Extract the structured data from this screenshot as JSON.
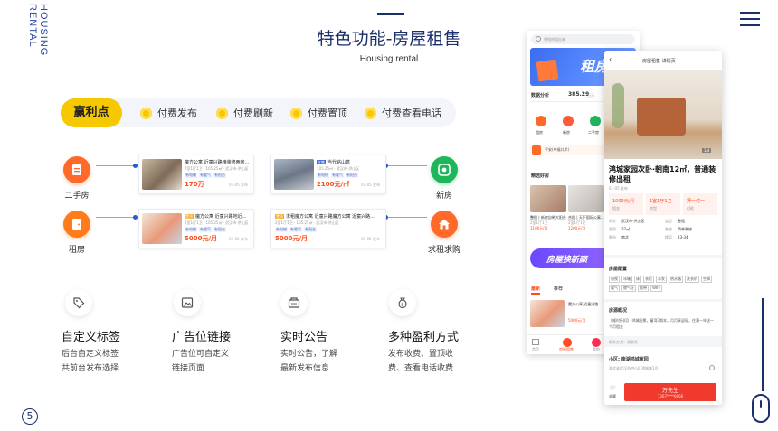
{
  "brand": {
    "line1": "HOUSING",
    "line2": "RENTAL"
  },
  "header": {
    "title": "特色功能-房屋租售",
    "subtitle": "Housing rental"
  },
  "monetize": {
    "label": "赢利点",
    "items": [
      "付费发布",
      "付费刷新",
      "付费置顶",
      "付费查看电话"
    ]
  },
  "categories": {
    "used": "二手房",
    "new": "新房",
    "rent": "租房",
    "want": "求租求购"
  },
  "cards": [
    {
      "title": "魔方公寓 近童兴路精装修两房...",
      "sub": "2室1厅1卫 · 105.25㎡ · 武汉市-洪山区",
      "tags": [
        "有电梯",
        "有暖气",
        "有阳台"
      ],
      "price": "170万",
      "date": "01-05 发布"
    },
    {
      "tag": "在售",
      "title": "当代铭山筑",
      "sub": "105.25㎡ · 武汉市-洪山区",
      "tags": [
        "有电梯",
        "有暖气",
        "有阳台"
      ],
      "price": "2100元/㎡",
      "date": "01-05 发布"
    },
    {
      "tag": "置顶",
      "title": "魔方公寓 近童兴路地近...",
      "sub": "2室1厅1卫 · 105.25㎡ · 武汉市-洪山区",
      "tags": [
        "有电梯",
        "有暖气",
        "有阳台"
      ],
      "price": "5000元/月",
      "date": "01-05 发布"
    },
    {
      "tag": "置顶",
      "title": "求租魔方公寓 近童兴路魔方公寓 近童兴路...",
      "sub": "2室1厅1卫 · 105.25㎡ · 武汉市-洪山区",
      "tags": [
        "有电梯",
        "有暖气",
        "有阳台"
      ],
      "price": "5000元/月",
      "date": "01-05 发布"
    }
  ],
  "features": [
    {
      "title": "自定义标签",
      "desc": "后台自定义标签 共前台发布选择"
    },
    {
      "title": "广告位链接",
      "desc": "广告位可自定义 链接页面"
    },
    {
      "title": "实时公告",
      "desc": "实时公告，了解 最新发布信息"
    },
    {
      "title": "多种盈利方式",
      "desc": "发布收费、置顶收 费、查看电话收费"
    }
  ],
  "page_number": "5",
  "phone1": {
    "search_placeholder": "想找的租出来",
    "banner": "租房",
    "stats_label": "数据分析",
    "stats_value": "385.29",
    "stats_unit": "万元",
    "shortcuts": [
      "租房",
      "新房",
      "二手房"
    ],
    "notice": "平安(幸福口岸)",
    "section": "精选好房",
    "picks": [
      {
        "title": "整租 | 新房自带大阳台...",
        "spec": "2室1厅1卫",
        "price": "1100元/月"
      },
      {
        "title": "合租 | 天下国际公寓...",
        "spec": "2室1厅1卫",
        "price": "1200元/月"
      }
    ],
    "promo": "房屋换新颜",
    "tabs": [
      "最新",
      "推荐"
    ],
    "latest_title": "魔方公寓 近童兴路...",
    "latest_price": "5000元/月",
    "nav": [
      "首页",
      "房屋租售",
      "我的"
    ]
  },
  "phone2": {
    "header": "房屋租售-详情页",
    "photo_count": "1/4",
    "title": "鸿城家园次卧·朝南12㎡，普通装修出租",
    "date": "01-05 发布",
    "price_boxes": [
      {
        "value": "1000元/月",
        "label": "租金"
      },
      {
        "value": "1室1厅1卫",
        "label": "房型"
      },
      {
        "value": "押一付一",
        "label": "付款"
      }
    ],
    "info": [
      [
        "地址",
        "武汉市-洪山区",
        "类型",
        "整租"
      ],
      [
        "面积",
        "32㎡",
        "装修",
        "简单装修"
      ],
      [
        "朝向",
        "南北",
        "楼层",
        "23-34"
      ]
    ],
    "config_title": "房屋配置",
    "config_items": [
      "电视",
      "冰箱",
      "床",
      "衣柜",
      "沙发",
      "热水器",
      "洗衣机",
      "空调",
      "暖气",
      "燃气灶",
      "宽带",
      "WIFI"
    ],
    "desc_title": "房源概况",
    "desc_text": "【顺时折扣】-鸿城园景，童湾3期本，月月享返现，住满一年送一个月租金",
    "notice": "联系方式：请联系",
    "community_label": "小区: 南湖鸿城家园",
    "community_addr": "湖北省武汉市洪山区鸿城路1号",
    "fav": "收藏",
    "contact_name": "万先生",
    "contact_phone": "1367****6666"
  },
  "colors": {
    "navy": "#1b2f6b",
    "yellow": "#f5c800",
    "orange": "#ff6a2b",
    "green": "#1fb65b",
    "red": "#ff4b1f"
  }
}
